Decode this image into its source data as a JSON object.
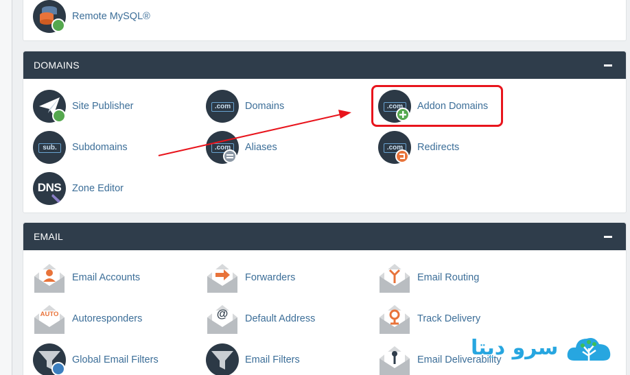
{
  "mysql_section": {
    "remote_mysql_label": "Remote MySQL®"
  },
  "domains": {
    "title": "DOMAINS",
    "items": [
      {
        "label": "Site Publisher",
        "icon": "paper-plane-icon"
      },
      {
        "label": "Domains",
        "icon": "dot-com-icon",
        "icon_text": ".com"
      },
      {
        "label": "Addon Domains",
        "icon": "dot-com-plus-icon",
        "icon_text": ".com"
      },
      {
        "label": "Subdomains",
        "icon": "subdomain-icon",
        "icon_text": "sub."
      },
      {
        "label": "Aliases",
        "icon": "dot-com-equals-icon",
        "icon_text": ".com"
      },
      {
        "label": "Redirects",
        "icon": "dot-com-redirect-icon",
        "icon_text": ".com"
      },
      {
        "label": "Zone Editor",
        "icon": "dns-icon",
        "icon_text": "DNS"
      }
    ]
  },
  "email": {
    "title": "EMAIL",
    "items": [
      {
        "label": "Email Accounts",
        "icon": "envelope-person-icon"
      },
      {
        "label": "Forwarders",
        "icon": "envelope-arrow-icon"
      },
      {
        "label": "Email Routing",
        "icon": "envelope-routing-icon"
      },
      {
        "label": "Autoresponders",
        "icon": "envelope-auto-icon",
        "icon_text": "AUTO"
      },
      {
        "label": "Default Address",
        "icon": "envelope-at-icon",
        "icon_text": "@"
      },
      {
        "label": "Track Delivery",
        "icon": "envelope-pin-icon"
      },
      {
        "label": "Global Email Filters",
        "icon": "funnel-globe-icon"
      },
      {
        "label": "Email Filters",
        "icon": "funnel-icon"
      },
      {
        "label": "Email Deliverability",
        "icon": "envelope-key-icon"
      }
    ]
  },
  "watermark": {
    "text": "سرو دیتا"
  },
  "colors": {
    "panel_header": "#2f3d4b",
    "link": "#3c6e98",
    "highlight": "#e8141c",
    "icon_circle": "#2c3946",
    "badge_green": "#55a84e",
    "badge_orange": "#e8733a",
    "badge_gray": "#8d99a6",
    "watermark": "#27a6e0"
  }
}
